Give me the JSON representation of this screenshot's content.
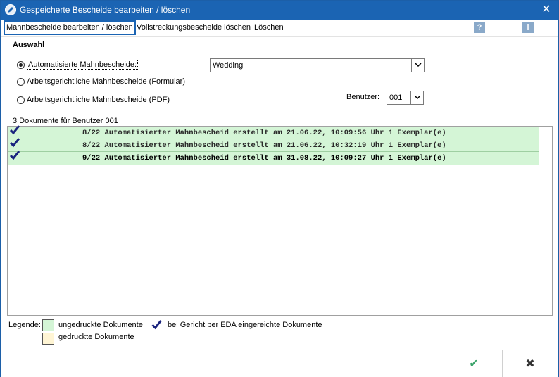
{
  "window": {
    "title": "Gespeicherte Bescheide bearbeiten / löschen",
    "close_glyph": "✕"
  },
  "menu": [
    {
      "label": "Mahnbescheide bearbeiten / löschen"
    },
    {
      "label": "Vollstreckungsbescheide löschen"
    },
    {
      "label": "Löschen"
    }
  ],
  "help_icon": "?",
  "info_icon": "i",
  "auswahl": {
    "heading": "Auswahl",
    "options": [
      {
        "label": "Automatisierte Mahnbescheide:",
        "selected": true
      },
      {
        "label": "Arbeitsgerichtliche Mahnbescheide (Formular)",
        "selected": false
      },
      {
        "label": "Arbeitsgerichtliche Mahnbescheide (PDF)",
        "selected": false
      }
    ],
    "court_select": {
      "value": "Wedding"
    },
    "user": {
      "label": "Benutzer:",
      "value": "001"
    }
  },
  "list": {
    "caption": "3 Dokumente für Benutzer 001",
    "rows": [
      {
        "text": "8/22 Automatisierter Mahnbescheid erstellt am 21.06.22, 10:09:56 Uhr 1 Exemplar(e)",
        "checked": true
      },
      {
        "text": "8/22 Automatisierter Mahnbescheid erstellt am 21.06.22, 10:32:19 Uhr 1 Exemplar(e)",
        "checked": true
      },
      {
        "text": "9/22 Automatisierter Mahnbescheid erstellt am 31.08.22, 10:09:27 Uhr 1 Exemplar(e)",
        "checked": true
      }
    ]
  },
  "legend": {
    "label": "Legende:",
    "unprinted": "ungedruckte Dokumente",
    "printed": "gedruckte Dokumente",
    "eda": "bei Gericht per EDA eingereichte Dokumente",
    "colors": {
      "unprinted": "#d4f5d6",
      "printed": "#fff5d4",
      "check": "#1a237e"
    }
  },
  "footer": {
    "ok_glyph": "✔",
    "cancel_glyph": "✖"
  }
}
